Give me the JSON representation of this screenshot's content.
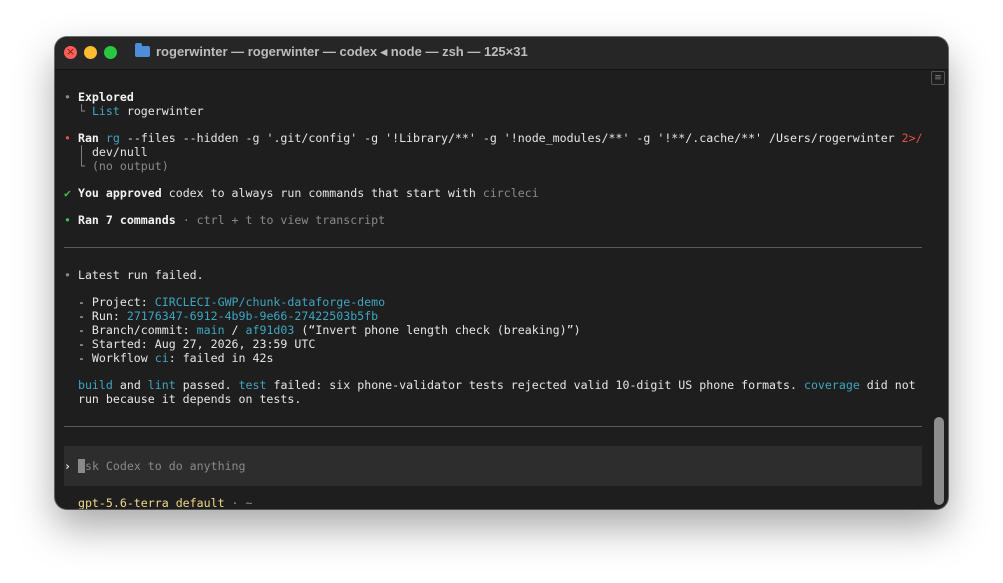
{
  "window": {
    "title": "rogerwinter — rogerwinter — codex ◂ node — zsh — 125×31"
  },
  "explored": {
    "heading": "Explored",
    "item_verb": "List",
    "item_target": "rogerwinter"
  },
  "ran_cmd": {
    "label": "Ran",
    "cmd_name": "rg",
    "args_line1": "--files --hidden -g '.git/config' -g '!Library/**' -g '!node_modules/**' -g '!**/.cache/**' /Users/rogerwinter",
    "redirect": "2>/",
    "args_line2": "dev/null",
    "output": "(no output)"
  },
  "approved": {
    "you": "You",
    "approved": "approved",
    "rest": "codex to always run commands that start with",
    "prefix": "circleci"
  },
  "ran_summary": {
    "label": "Ran 7 commands",
    "hint": "· ctrl + t to view transcript"
  },
  "result": {
    "heading": "Latest run failed.",
    "project_label": "- Project:",
    "project_value": "CIRCLECI-GWP/chunk-dataforge-demo",
    "run_label": "- Run:",
    "run_value": "27176347-6912-4b9b-9e66-27422503b5fb",
    "branch_label": "- Branch/commit:",
    "branch_value": "main",
    "branch_sep": "/",
    "commit_value": "af91d03",
    "commit_msg": "(“Invert phone length check (breaking)”)",
    "started_label": "- Started:",
    "started_value": "Aug 27, 2026, 23:59 UTC",
    "workflow_label": "- Workflow",
    "workflow_name": "ci",
    "workflow_status": ": failed in 42s",
    "summary_build": "build",
    "summary_and": "and",
    "summary_lint": "lint",
    "summary_passed": "passed.",
    "summary_test": "test",
    "summary_failed": "failed: six phone-validator tests rejected valid 10-digit US phone formats.",
    "summary_coverage": "coverage",
    "summary_tail1": "did not",
    "summary_tail2": "run because it depends on tests."
  },
  "input": {
    "prompt": "›",
    "placeholder": "Ask Codex to do anything"
  },
  "footer": {
    "model": "gpt-5.6-terra default",
    "path": "· ~"
  },
  "colors": {
    "background": "#1e1e1e",
    "accent_cyan": "#3ea6c0",
    "error_red": "#e0514a",
    "success_green": "#3fbf4d"
  }
}
